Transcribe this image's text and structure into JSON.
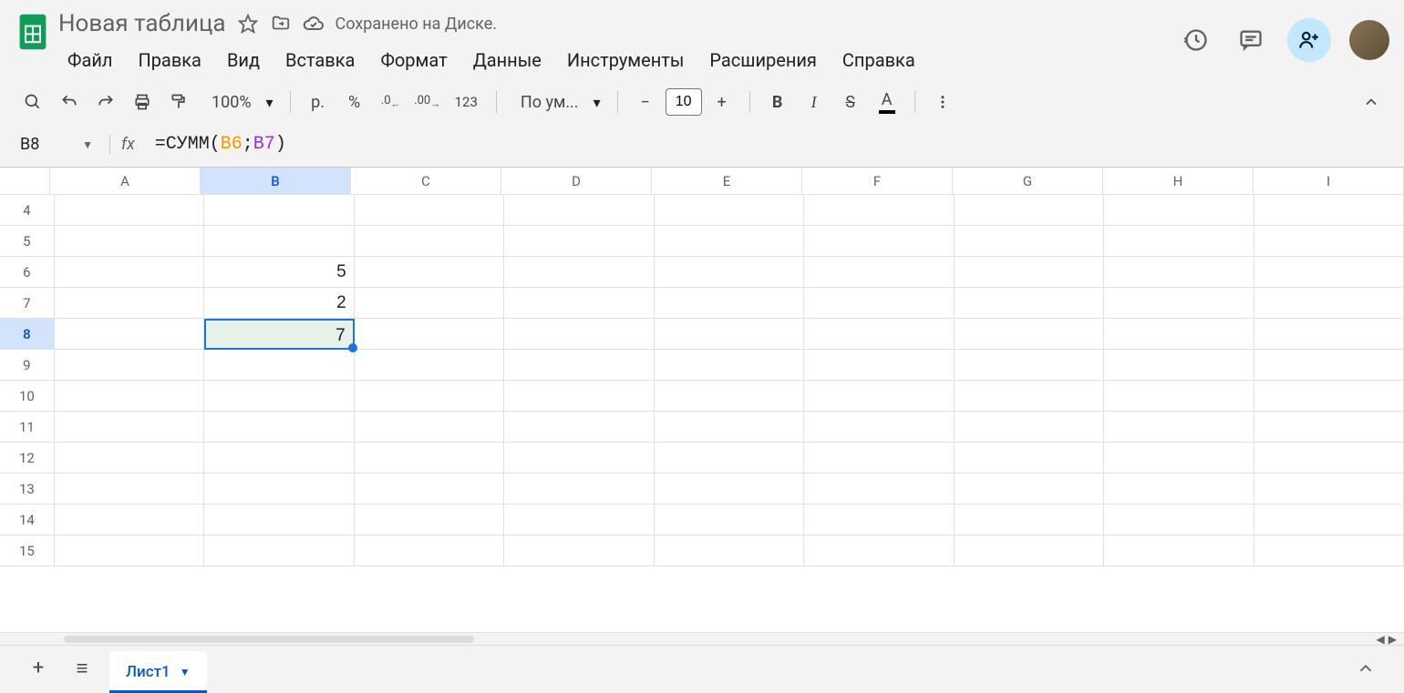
{
  "header": {
    "doc_title": "Новая таблица",
    "save_status": "Сохранено на Диске."
  },
  "menu": {
    "file": "Файл",
    "edit": "Правка",
    "view": "Вид",
    "insert": "Вставка",
    "format": "Формат",
    "data": "Данные",
    "tools": "Инструменты",
    "extensions": "Расширения",
    "help": "Справка"
  },
  "toolbar": {
    "zoom": "100%",
    "currency": "р.",
    "percent": "%",
    "dec_dec": ".0",
    "inc_dec": ".00",
    "num123": "123",
    "font": "По ум...",
    "font_size": "10",
    "bold": "B",
    "italic": "I"
  },
  "formula_bar": {
    "name_box": "B8",
    "fx": "fx",
    "prefix": "=СУММ(",
    "ref1": "B6",
    "sep": ";",
    "ref2": "B7",
    "suffix": ")"
  },
  "grid": {
    "columns": [
      "A",
      "B",
      "C",
      "D",
      "E",
      "F",
      "G",
      "H",
      "I"
    ],
    "selected_col": "B",
    "rows": [
      4,
      5,
      6,
      7,
      8,
      9,
      10,
      11,
      12,
      13,
      14,
      15
    ],
    "selected_row": 8,
    "cells": {
      "B6": "5",
      "B7": "2",
      "B8": "7"
    },
    "selected_cell": "B8"
  },
  "sheets": {
    "active": "Лист1"
  }
}
